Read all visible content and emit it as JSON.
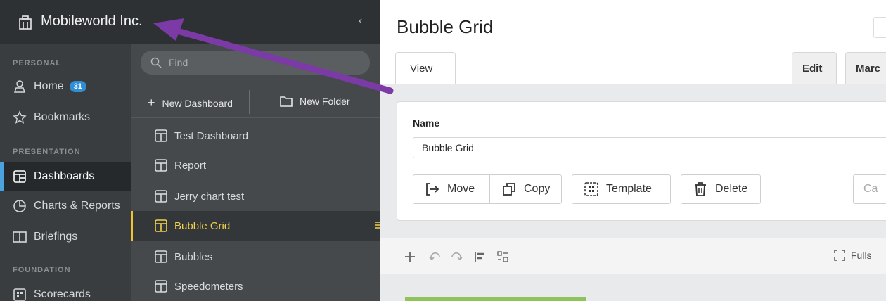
{
  "org": {
    "name": "Mobileworld Inc.",
    "collapse_glyph": "‹"
  },
  "nav": {
    "sections": {
      "personal": "PERSONAL",
      "presentation": "PRESENTATION",
      "foundation": "FOUNDATION"
    },
    "items": {
      "home": {
        "label": "Home",
        "badge": "31"
      },
      "bookmarks": {
        "label": "Bookmarks"
      },
      "dashboards": {
        "label": "Dashboards"
      },
      "charts": {
        "label": "Charts & Reports"
      },
      "briefings": {
        "label": "Briefings"
      },
      "scorecards": {
        "label": "Scorecards"
      }
    }
  },
  "panel": {
    "search_placeholder": "Find",
    "new_dashboard": "New Dashboard",
    "new_folder": "New Folder",
    "dashboards": [
      {
        "label": "Test Dashboard"
      },
      {
        "label": "Report"
      },
      {
        "label": "Jerry chart test"
      },
      {
        "label": "Bubble Grid"
      },
      {
        "label": "Bubbles"
      },
      {
        "label": "Speedometers"
      }
    ]
  },
  "content": {
    "title": "Bubble Grid",
    "tabs": {
      "view": "View",
      "edit": "Edit",
      "more": "Marc"
    },
    "name_label": "Name",
    "name_value": "Bubble Grid",
    "buttons": {
      "move": "Move",
      "copy": "Copy",
      "template": "Template",
      "delete": "Delete",
      "cancel_partial": "Ca"
    },
    "fullscreen_partial": "Fulls"
  },
  "colors": {
    "accent_blue": "#4aa3df",
    "selected_yellow": "#f1d24b",
    "arrow_purple": "#7b3aa6"
  }
}
